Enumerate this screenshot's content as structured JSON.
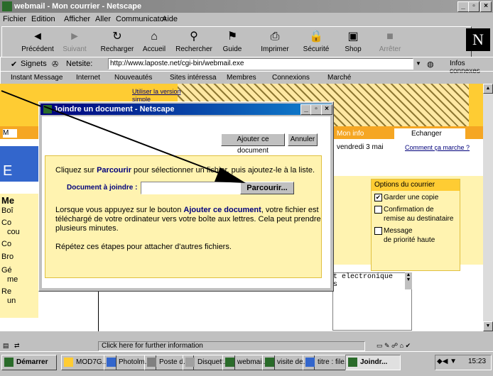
{
  "window": {
    "title": "webmail - Mon courrier - Netscape"
  },
  "menu": [
    "Fichier",
    "Edition",
    "Afficher",
    "Aller",
    "Communicator",
    "Aide"
  ],
  "toolbar": [
    {
      "label": "Précédent",
      "icon": "back-icon",
      "enabled": true
    },
    {
      "label": "Suivant",
      "icon": "forward-icon",
      "enabled": false
    },
    {
      "label": "Recharger",
      "icon": "reload-icon",
      "enabled": true
    },
    {
      "label": "Accueil",
      "icon": "home-icon",
      "enabled": true
    },
    {
      "label": "Rechercher",
      "icon": "search-icon",
      "enabled": true
    },
    {
      "label": "Guide",
      "icon": "guide-icon",
      "enabled": true
    },
    {
      "label": "Imprimer",
      "icon": "print-icon",
      "enabled": true
    },
    {
      "label": "Sécurité",
      "icon": "security-icon",
      "enabled": true
    },
    {
      "label": "Shop",
      "icon": "shop-icon",
      "enabled": true
    },
    {
      "label": "Arrêter",
      "icon": "stop-icon",
      "enabled": false
    }
  ],
  "netscape_logo": "N",
  "location": {
    "bookmarks_label": "Signets",
    "address_label": "Netsite:",
    "url": "http://www.laposte.net/cgi-bin/webmail.exe",
    "related_label": "Infos connexes"
  },
  "personal_toolbar": [
    "Instant Message",
    "Internet",
    "Nouveautés",
    "Sites intéressa",
    "Membres",
    "Connexions",
    "Marché"
  ],
  "page": {
    "link_version": "Utiliser la version",
    "link_version2": "simple",
    "mon_info": "Mon info",
    "echanger": "Echanger",
    "date": "vendredi 3 mai",
    "comment_link": "Comment ça marche ?",
    "left_tab": "M",
    "mes_label": "Me",
    "left_items": [
      "Boî",
      "Co",
      "cou",
      "Co",
      "Bro",
      "Gé",
      "me",
      "Re",
      "un"
    ],
    "letter_e": "E",
    "options": {
      "title": "Options du courrier",
      "items": [
        {
          "label": "Garder une copie",
          "checked": true
        },
        {
          "label": "Confirmation de",
          "label2": "remise au destinataire",
          "checked": false
        },
        {
          "label": "Message",
          "label2": "de priorité haute",
          "checked": false
        }
      ]
    },
    "textarea_line1": "t electronique",
    "textarea_line2": "s"
  },
  "dialog": {
    "title": "Joindre un document - Netscape",
    "add_button": "Ajouter ce document",
    "cancel_button": "Annuler",
    "intro_prefix": "Cliquez sur ",
    "intro_bold": "Parcourir",
    "intro_suffix": " pour sélectionner un fichier, puis ajoutez-le à la liste.",
    "field_label": "Document à joindre :",
    "field_value": "",
    "browse_button": "Parcourir...",
    "p2_prefix": "Lorsque vous appuyez sur le bouton ",
    "p2_bold": "Ajouter ce document",
    "p2_line1_suffix": ", votre fichier est",
    "p2_line2": "téléchargé de votre ordinateur vers votre boîte aux lettres. Cela peut prendre",
    "p2_line3": "plusieurs minutes.",
    "p3": "Répétez ces étapes pour attacher d'autres fichiers."
  },
  "status": {
    "text": "Click here for further information"
  },
  "taskbar": {
    "start": "Démarrer",
    "tasks": [
      "MOD7G...",
      "Photolm...",
      "Poste d...",
      "Disquett...",
      "webmail...",
      "visite de...",
      "titre : file...",
      "Joindr..."
    ],
    "clock": "15:23"
  }
}
